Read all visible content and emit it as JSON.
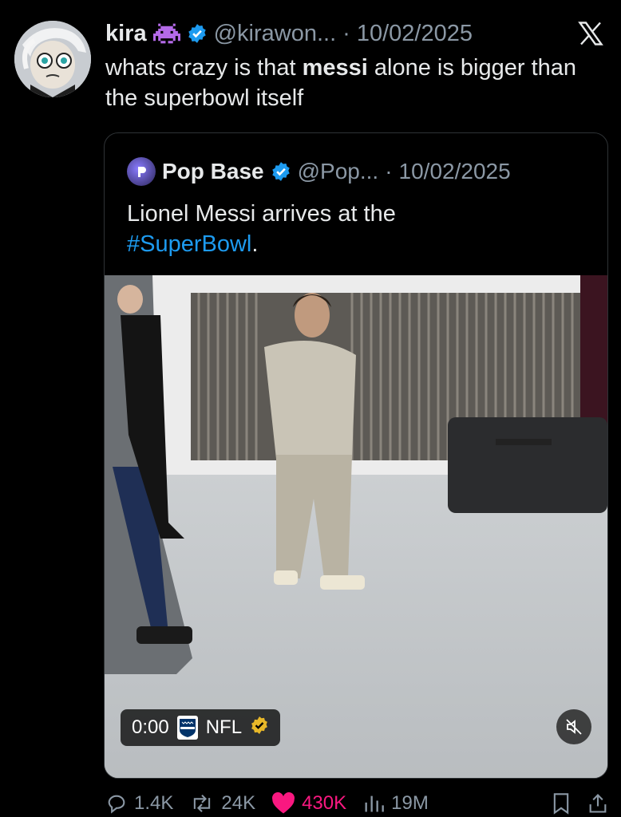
{
  "tweet": {
    "author_name": "kira",
    "handle": "@kirawon...",
    "date_prefix": "·",
    "date": "10/02/2025",
    "text_before": "whats crazy is that ",
    "text_bold": "messi",
    "text_after": " alone is bigger than the superbowl itself"
  },
  "quoted_tweet": {
    "author_name": "Pop Base",
    "handle": "@Pop...",
    "date_prefix": "·",
    "date": "10/02/2025",
    "text": "Lionel Messi arrives at the ",
    "hashtag": "#SuperBowl",
    "text_end": ".",
    "video": {
      "timestamp": "0:00",
      "channel": "NFL"
    }
  },
  "actions": {
    "replies": "1.4K",
    "reposts": "24K",
    "likes": "430K",
    "views": "19M"
  },
  "colors": {
    "background": "#000000",
    "text": "#e7e9ea",
    "muted": "#8b98a5",
    "verified": "#1d9bf0",
    "gold_check": "#e8b829",
    "like": "#f91880",
    "hashtag": "#1d9bf0"
  },
  "icons": [
    "space-invader-icon",
    "verified-badge-icon",
    "x-logo-icon",
    "reply-icon",
    "repost-icon",
    "like-heart-icon",
    "views-icon",
    "bookmark-icon",
    "share-icon",
    "mute-icon",
    "nfl-logo-icon"
  ]
}
